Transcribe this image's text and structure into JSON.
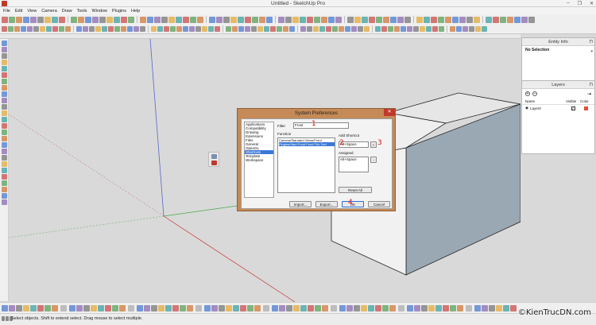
{
  "window": {
    "title": "Untitled - SketchUp Pro",
    "controls": [
      "–",
      "❐",
      "✕"
    ]
  },
  "menu": [
    "File",
    "Edit",
    "View",
    "Camera",
    "Draw",
    "Tools",
    "Window",
    "Plugins",
    "Help"
  ],
  "entity_info": {
    "title": "Entity Info",
    "selection": "No Selection"
  },
  "layers": {
    "title": "Layers",
    "columns": {
      "name": "Name",
      "visible": "Visible",
      "color": "Color"
    },
    "rows": [
      {
        "name": "Layer0",
        "visible": true,
        "color": "#e74c3c"
      }
    ]
  },
  "dialog": {
    "title": "System Preferences",
    "categories": [
      "Applications",
      "Compatibility",
      "Drawing",
      "Extensions",
      "Files",
      "General",
      "OpenGL",
      "Shortcuts",
      "Template",
      "Workspace"
    ],
    "selected_category": "Shortcuts",
    "filter_label": "Filter",
    "filter_value": "Front",
    "function_label": "Function",
    "functions": [
      "Camera/Standard Views/Front",
      "Plugins/Start Front Front Thk Tool"
    ],
    "selected_function_index": 1,
    "add_shortcut_label": "Add Shortcut",
    "add_shortcut_value": "Alt+Space",
    "add_button": "+",
    "assigned_label": "Assigned",
    "assigned_value": "Alt+Space",
    "remove_button": "-",
    "reset_all": "Reset All",
    "import": "Import...",
    "export": "Export...",
    "ok": "OK",
    "cancel": "Cancel",
    "annotations": [
      "1",
      "2",
      "3",
      "4"
    ]
  },
  "status": {
    "hint": "Select objects. Shift to extend select. Drag mouse to select multiple."
  },
  "watermark": "©KienTrucDN.com",
  "colors": {
    "accent": "#3b78d8",
    "dialog_frame": "#c58a57",
    "annotation": "#dd1111",
    "box_dark": "#9aa8b4"
  }
}
